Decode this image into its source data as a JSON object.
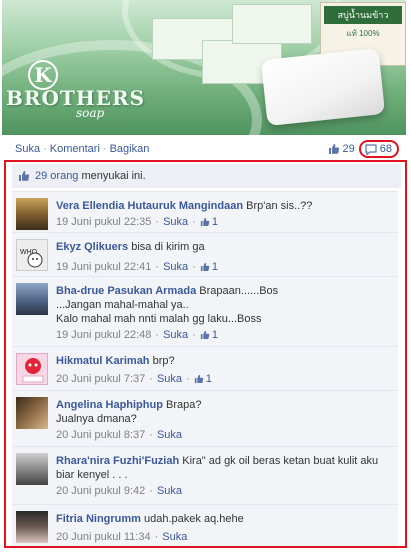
{
  "banner": {
    "logo_letter": "K",
    "brand": "BROTHERS",
    "brand_sub": "soap",
    "package_label": "สบู่น้ำนมข้าว",
    "package_sublabel": "แท้ 100%"
  },
  "actions": {
    "like": "Suka",
    "comment": "Komentari",
    "share": "Bagikan",
    "separator": "·"
  },
  "counts": {
    "likes": "29",
    "comments": "68"
  },
  "likes_row": {
    "people": "29 orang",
    "suffix": "menyukai ini."
  },
  "comments": [
    {
      "author": "Vera Ellendia Hutauruk Mangindaan",
      "text": "Brp'an sis..??",
      "time": "19 Juni pukul 22:35",
      "like": "Suka",
      "likes": "1"
    },
    {
      "author": "Ekyz Qlikuers",
      "text": "bisa di kirim ga",
      "time": "19 Juni pukul 22:41",
      "like": "Suka",
      "likes": "1"
    },
    {
      "author": "Bha-drue Pasukan Armada",
      "text": "Brapaan......Bos",
      "text2": "...Jangan mahal-mahal ya..",
      "text3": "Kalo mahal mah nnti malah gg laku...Boss",
      "time": "19 Juni pukul 22:48",
      "like": "Suka",
      "likes": "1"
    },
    {
      "author": "Hikmatul Karimah",
      "text": "brp?",
      "time": "20 Juni pukul 7:37",
      "like": "Suka",
      "likes": "1"
    },
    {
      "author": "Angelina Haphiphup",
      "text": "Brapa?",
      "text2": "Jualnya dmana?",
      "time": "20 Juni pukul 8:37",
      "like": "Suka"
    },
    {
      "author": "Rhara'nira Fuzhi'Fuziah",
      "text": "Kira\" ad gk oil beras ketan buat kulit aku",
      "text2": "biar kenyel . . .",
      "time": "20 Juni pukul 9:42",
      "like": "Suka"
    },
    {
      "author": "Fitria Ningrumm",
      "text": "udah.pakek aq.hehe",
      "time": "20 Juni pukul 11:34",
      "like": "Suka"
    }
  ],
  "colors": {
    "link": "#3b5998",
    "highlight": "#e0141e",
    "panel_bg": "#f2f4f8"
  },
  "icons": {
    "like": "thumbs-up-icon",
    "comment": "comment-bubble-icon"
  }
}
